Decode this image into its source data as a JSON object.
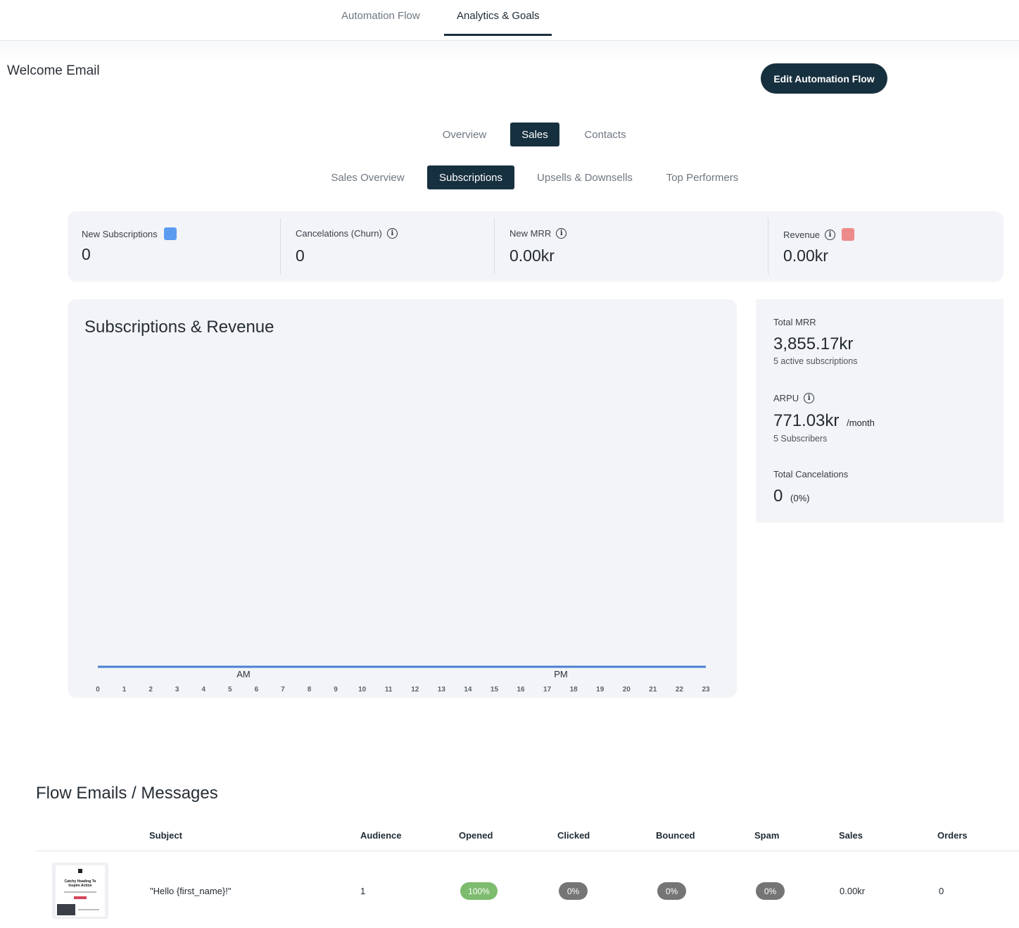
{
  "top_tabs": [
    "Automation Flow",
    "Analytics & Goals"
  ],
  "page_title": "Welcome Email",
  "edit_button": "Edit Automation Flow",
  "section_tabs": [
    "Overview",
    "Sales",
    "Contacts"
  ],
  "sales_tabs": [
    "Sales Overview",
    "Subscriptions",
    "Upsells & Downsells",
    "Top Performers"
  ],
  "stats": {
    "new_subscriptions": {
      "label": "New Subscriptions",
      "value": "0",
      "color": "#5b9cf0"
    },
    "cancelations": {
      "label": "Cancelations (Churn)",
      "value": "0"
    },
    "new_mrr": {
      "label": "New MRR",
      "value": "0.00kr"
    },
    "revenue": {
      "label": "Revenue",
      "value": "0.00kr",
      "color": "#ee8a8a"
    }
  },
  "chart": {
    "title": "Subscriptions & Revenue",
    "am_label": "AM",
    "pm_label": "PM"
  },
  "chart_data": {
    "type": "line",
    "title": "Subscriptions & Revenue",
    "x": [
      0,
      1,
      2,
      3,
      4,
      5,
      6,
      7,
      8,
      9,
      10,
      11,
      12,
      13,
      14,
      15,
      16,
      17,
      18,
      19,
      20,
      21,
      22,
      23
    ],
    "x_ticks": [
      "0",
      "1",
      "2",
      "3",
      "4",
      "5",
      "6",
      "7",
      "8",
      "9",
      "10",
      "11",
      "12",
      "13",
      "14",
      "15",
      "16",
      "17",
      "18",
      "19",
      "20",
      "21",
      "22",
      "23"
    ],
    "series": [
      {
        "color": "#4a7fd0",
        "values": [
          0,
          0,
          0,
          0,
          0,
          0,
          0,
          0,
          0,
          0,
          0,
          0,
          0,
          0,
          0,
          0,
          0,
          0,
          0,
          0,
          0,
          0,
          0,
          0
        ]
      }
    ],
    "grid": false
  },
  "summary": {
    "total_mrr_label": "Total MRR",
    "total_mrr_value": "3,855.17kr",
    "total_mrr_sub": "5 active subscriptions",
    "arpu_label": "ARPU",
    "arpu_value": "771.03kr",
    "arpu_unit": "/month",
    "arpu_sub": "5 Subscribers",
    "cancel_label": "Total Cancelations",
    "cancel_value": "0",
    "cancel_pct": "(0%)"
  },
  "flow": {
    "title": "Flow Emails / Messages",
    "headers": [
      "Subject",
      "Audience",
      "Opened",
      "Clicked",
      "Bounced",
      "Spam",
      "Sales",
      "Orders"
    ],
    "row": {
      "subject": "\"Hello {first_name}!\"",
      "audience": "1",
      "opened": "100%",
      "clicked": "0%",
      "bounced": "0%",
      "spam": "0%",
      "sales": "0.00kr",
      "orders": "0"
    },
    "thumb_heading": "Catchy Heading To Inspire Action"
  }
}
